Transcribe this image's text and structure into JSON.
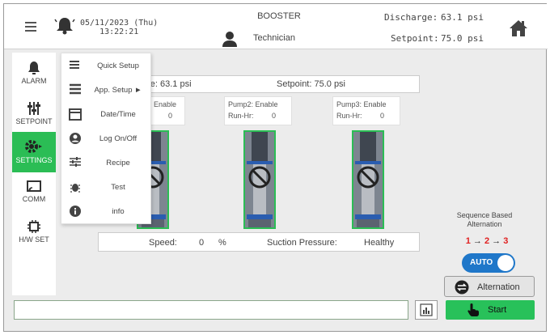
{
  "header": {
    "datetime_line1": "05/11/2023 (Thu)",
    "datetime_line2": "13:22:21",
    "system_name": "BOOSTER",
    "user_role": "Technician",
    "discharge_label": "Discharge:",
    "discharge_value": "63.1 psi",
    "setpoint_label": "Setpoint:",
    "setpoint_value": "75.0 psi"
  },
  "sidebar": {
    "items": [
      {
        "label": "ALARM"
      },
      {
        "label": "SETPOINT"
      },
      {
        "label": "SETTINGS"
      },
      {
        "label": "COMM"
      },
      {
        "label": "H/W SET"
      }
    ],
    "active": "SETTINGS"
  },
  "menu": {
    "items": [
      {
        "label": "Quick Setup"
      },
      {
        "label": "App. Setup ►"
      },
      {
        "label": "Date/Time"
      },
      {
        "label": "Log On/Off"
      },
      {
        "label": "Recipe"
      },
      {
        "label": "Test"
      },
      {
        "label": "info"
      }
    ]
  },
  "status": {
    "discharge_partial": "rge: 63.1 psi",
    "setpoint_text": "Setpoint: 75.0 psi"
  },
  "pumps": [
    {
      "line1": "Enable",
      "line2": "0"
    },
    {
      "line1": "Pump2: Enable",
      "line2_label": "Run-Hr:",
      "line2_value": "0"
    },
    {
      "line1": "Pump3: Enable",
      "line2_label": "Run-Hr:",
      "line2_value": "0"
    }
  ],
  "bottom_status": {
    "speed_label": "Speed:",
    "speed_value": "0",
    "speed_unit": "%",
    "suction_label": "Suction Pressure:",
    "suction_value": "Healthy"
  },
  "alternation": {
    "title_line1": "Sequence Based",
    "title_line2": "Alternation",
    "seq_1": "1",
    "seq_2": "2",
    "seq_3": "3",
    "seq_arrow": "→",
    "toggle_label": "AUTO",
    "toggle_on": true,
    "button_label": "Alternation"
  },
  "actions": {
    "start_label": "Start"
  },
  "colors": {
    "accent_green": "#2bbd55",
    "toggle_blue": "#1f77c9",
    "sequence_red": "#e02020",
    "sequence_text": "#222222"
  }
}
